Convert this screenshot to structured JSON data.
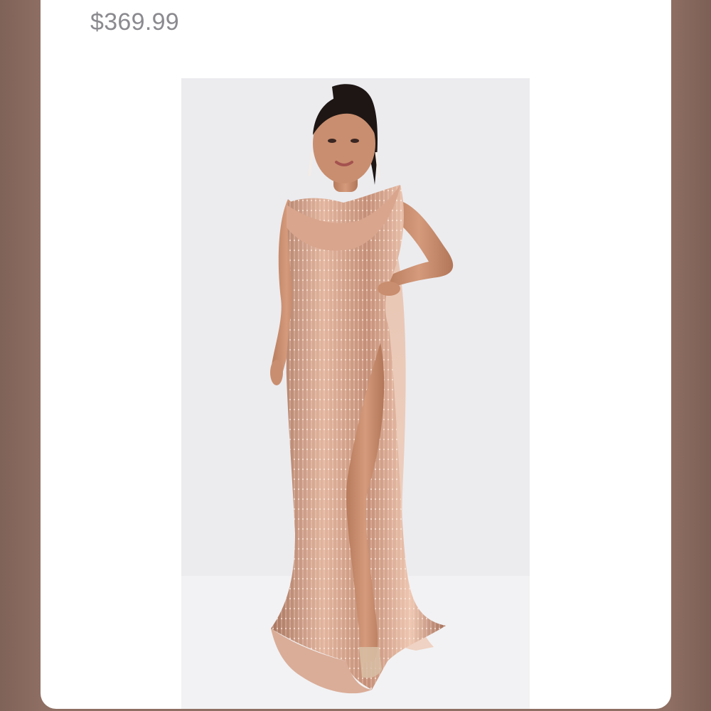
{
  "listing": {
    "price": "$369.99"
  },
  "image": {
    "subject": "model-in-rose-gold-sequin-gown",
    "colors": {
      "backdrop": "#ebebee",
      "gown": "#c99780",
      "gown_highlight": "#f2d2bf",
      "skin": "#c98e6f",
      "hair": "#1e1614",
      "chiffon": "#e8c2b0"
    }
  },
  "frame": {
    "colors": {
      "outer_background": "#8f6f63",
      "card": "#ffffff",
      "price_text": "#8a8a8f"
    }
  }
}
